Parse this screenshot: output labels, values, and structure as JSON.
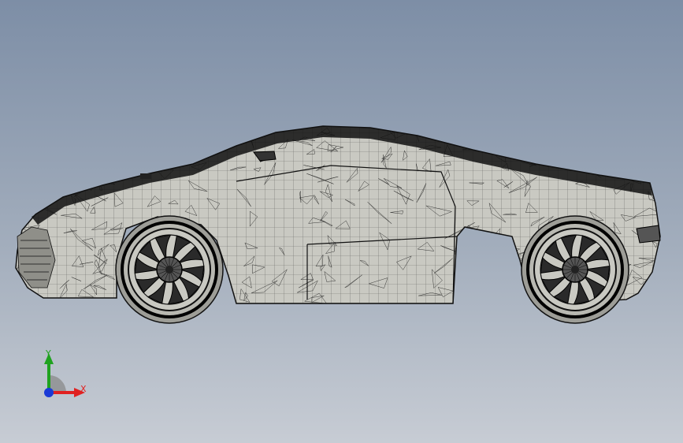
{
  "viewport": {
    "background_top": "#7d8ea6",
    "background_bottom": "#c7ccd4"
  },
  "model": {
    "display_mode": "wireframe",
    "body_fill": "#c9c9c2",
    "edge_color": "#111111",
    "wheel_icon": "wheel-icon"
  },
  "triad": {
    "y_label": "Y",
    "x_label": "X",
    "y_color": "#1fa21f",
    "x_color": "#e02020",
    "z_color": "#1a3ad6"
  }
}
